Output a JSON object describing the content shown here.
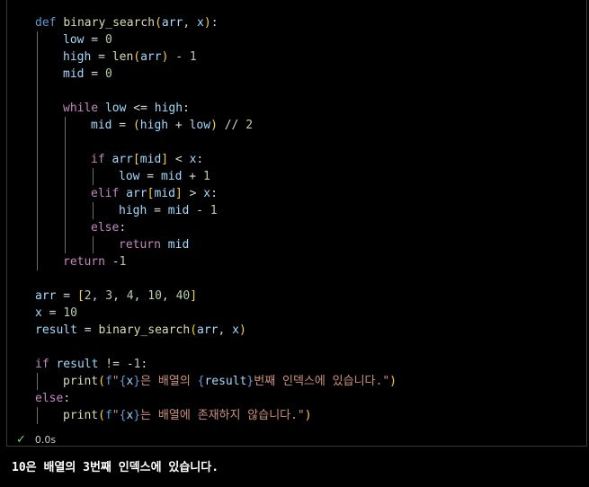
{
  "cell": {
    "lines": [
      [
        [
          "kw",
          "def "
        ],
        [
          "fn",
          "binary_search"
        ],
        [
          "pn1",
          "("
        ],
        [
          "var",
          "arr"
        ],
        [
          "op",
          ", "
        ],
        [
          "var",
          "x"
        ],
        [
          "pn1",
          ")"
        ],
        [
          "op",
          ":"
        ]
      ],
      [
        [
          "var",
          "low"
        ],
        [
          "op",
          " = "
        ],
        [
          "num",
          "0"
        ]
      ],
      [
        [
          "var",
          "high"
        ],
        [
          "op",
          " = "
        ],
        [
          "fn",
          "len"
        ],
        [
          "pn1",
          "("
        ],
        [
          "var",
          "arr"
        ],
        [
          "pn1",
          ")"
        ],
        [
          "op",
          " - "
        ],
        [
          "num",
          "1"
        ]
      ],
      [
        [
          "var",
          "mid"
        ],
        [
          "op",
          " = "
        ],
        [
          "num",
          "0"
        ]
      ],
      [],
      [
        [
          "kwc",
          "while "
        ],
        [
          "var",
          "low"
        ],
        [
          "op",
          " <= "
        ],
        [
          "var",
          "high"
        ],
        [
          "op",
          ":"
        ]
      ],
      [
        [
          "var",
          "mid"
        ],
        [
          "op",
          " = "
        ],
        [
          "pn1",
          "("
        ],
        [
          "var",
          "high"
        ],
        [
          "op",
          " + "
        ],
        [
          "var",
          "low"
        ],
        [
          "pn1",
          ")"
        ],
        [
          "op",
          " // "
        ],
        [
          "num",
          "2"
        ]
      ],
      [],
      [
        [
          "kwc",
          "if "
        ],
        [
          "var",
          "arr"
        ],
        [
          "pn1",
          "["
        ],
        [
          "var",
          "mid"
        ],
        [
          "pn1",
          "]"
        ],
        [
          "op",
          " < "
        ],
        [
          "var",
          "x"
        ],
        [
          "op",
          ":"
        ]
      ],
      [
        [
          "var",
          "low"
        ],
        [
          "op",
          " = "
        ],
        [
          "var",
          "mid"
        ],
        [
          "op",
          " + "
        ],
        [
          "num",
          "1"
        ]
      ],
      [
        [
          "kwc",
          "elif "
        ],
        [
          "var",
          "arr"
        ],
        [
          "pn1",
          "["
        ],
        [
          "var",
          "mid"
        ],
        [
          "pn1",
          "]"
        ],
        [
          "op",
          " > "
        ],
        [
          "var",
          "x"
        ],
        [
          "op",
          ":"
        ]
      ],
      [
        [
          "var",
          "high"
        ],
        [
          "op",
          " = "
        ],
        [
          "var",
          "mid"
        ],
        [
          "op",
          " - "
        ],
        [
          "num",
          "1"
        ]
      ],
      [
        [
          "kwc",
          "else"
        ],
        [
          "op",
          ":"
        ]
      ],
      [
        [
          "kwc",
          "return "
        ],
        [
          "var",
          "mid"
        ]
      ],
      [
        [
          "kwc",
          "return "
        ],
        [
          "op",
          "-"
        ],
        [
          "num",
          "1"
        ]
      ],
      [],
      [
        [
          "var",
          "arr"
        ],
        [
          "op",
          " = "
        ],
        [
          "pn1",
          "["
        ],
        [
          "num",
          "2"
        ],
        [
          "op",
          ", "
        ],
        [
          "num",
          "3"
        ],
        [
          "op",
          ", "
        ],
        [
          "num",
          "4"
        ],
        [
          "op",
          ", "
        ],
        [
          "num",
          "10"
        ],
        [
          "op",
          ", "
        ],
        [
          "num",
          "40"
        ],
        [
          "pn1",
          "]"
        ]
      ],
      [
        [
          "var",
          "x"
        ],
        [
          "op",
          " = "
        ],
        [
          "num",
          "10"
        ]
      ],
      [
        [
          "var",
          "result"
        ],
        [
          "op",
          " = "
        ],
        [
          "fn",
          "binary_search"
        ],
        [
          "pn1",
          "("
        ],
        [
          "var",
          "arr"
        ],
        [
          "op",
          ", "
        ],
        [
          "var",
          "x"
        ],
        [
          "pn1",
          ")"
        ]
      ],
      [],
      [
        [
          "kwc",
          "if "
        ],
        [
          "var",
          "result"
        ],
        [
          "op",
          " != "
        ],
        [
          "op",
          "-"
        ],
        [
          "num",
          "1"
        ],
        [
          "op",
          ":"
        ]
      ],
      [
        [
          "fn",
          "print"
        ],
        [
          "pn1",
          "("
        ],
        [
          "kw",
          "f"
        ],
        [
          "str",
          "\""
        ],
        [
          "kw",
          "{"
        ],
        [
          "var",
          "x"
        ],
        [
          "kw",
          "}"
        ],
        [
          "str",
          "은 배열의 "
        ],
        [
          "kw",
          "{"
        ],
        [
          "var",
          "result"
        ],
        [
          "kw",
          "}"
        ],
        [
          "str",
          "번째 인덱스에 있습니다.\""
        ],
        [
          "pn1",
          ")"
        ]
      ],
      [
        [
          "kwc",
          "else"
        ],
        [
          "op",
          ":"
        ]
      ],
      [
        [
          "fn",
          "print"
        ],
        [
          "pn1",
          "("
        ],
        [
          "kw",
          "f"
        ],
        [
          "str",
          "\""
        ],
        [
          "kw",
          "{"
        ],
        [
          "var",
          "x"
        ],
        [
          "kw",
          "}"
        ],
        [
          "str",
          "는 배열에 존재하지 않습니다.\""
        ],
        [
          "pn1",
          ")"
        ]
      ]
    ],
    "indents": [
      0,
      1,
      1,
      1,
      0,
      1,
      2,
      0,
      2,
      3,
      2,
      3,
      2,
      3,
      1,
      0,
      0,
      0,
      0,
      0,
      0,
      1,
      0,
      1
    ]
  },
  "status": {
    "time": "0.0s",
    "check_icon": "✓"
  },
  "output": {
    "text": "10은 배열의 3번째 인덱스에 있습니다."
  }
}
